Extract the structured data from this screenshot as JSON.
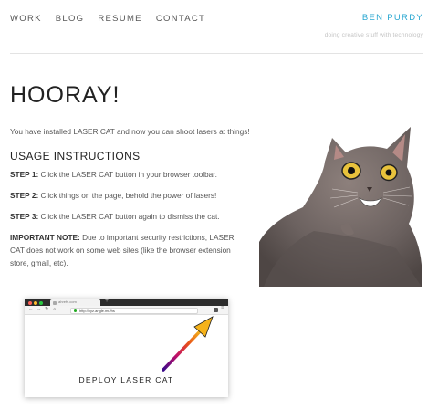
{
  "nav": {
    "items": [
      "WORK",
      "BLOG",
      "RESUME",
      "CONTACT"
    ]
  },
  "brand": {
    "name": "BEN PURDY",
    "tagline": "doing creative stuff with technology",
    "color": "#2aa7d1"
  },
  "main": {
    "title": "HOORAY!",
    "intro": "You have installed LASER CAT and now you can shoot lasers at things!",
    "heading": "USAGE INSTRUCTIONS",
    "steps": [
      {
        "label": "STEP 1:",
        "text": " Click the LASER CAT button in your browser toolbar."
      },
      {
        "label": "STEP 2:",
        "text": " Click things on the page, behold the power of lasers!"
      },
      {
        "label": "STEP 3:",
        "text": " Click the LASER CAT button again to dismiss the cat."
      },
      {
        "label": "IMPORTANT NOTE:",
        "text": " Due to important security restrictions, LASER CAT does not work on some web sites (like the browser extension store, gmail, etc)."
      }
    ]
  },
  "screenshot": {
    "tab_title": "ahrefs.com",
    "url": "http://xyz.angle.mu/hs",
    "caption": "DEPLOY LASER CAT"
  }
}
